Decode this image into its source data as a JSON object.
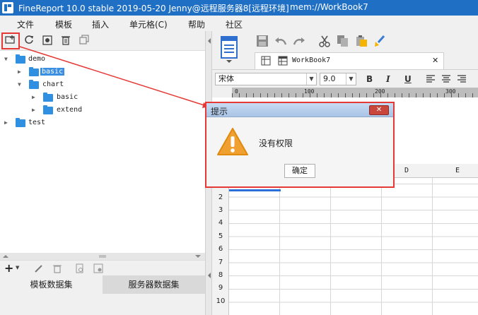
{
  "window": {
    "title": "FineReport 10.0 stable 2019-05-20 Jenny@远程服务器8[远程环境]",
    "path": "mem://WorkBook7"
  },
  "menu": [
    "文件",
    "模板",
    "插入",
    "单元格(C)",
    "帮助",
    "社区"
  ],
  "left_toolbar": {
    "icons": [
      "new-folder-icon",
      "refresh-icon",
      "settings-icon",
      "delete-icon",
      "copy-icon"
    ]
  },
  "tree": [
    {
      "label": "demo",
      "level": 0,
      "expanded": true
    },
    {
      "label": "basic",
      "level": 1,
      "expanded": false,
      "selected": true
    },
    {
      "label": "chart",
      "level": 1,
      "expanded": true
    },
    {
      "label": "basic",
      "level": 2,
      "expanded": false
    },
    {
      "label": "extend",
      "level": 2,
      "expanded": false
    },
    {
      "label": "test",
      "level": 0,
      "expanded": false
    }
  ],
  "left_tabs": [
    "模板数据集",
    "服务器数据集"
  ],
  "doc_tab": {
    "label": "WorkBook7"
  },
  "format": {
    "font": "宋体",
    "size": "9.0",
    "bold": "B",
    "italic": "I",
    "underline": "U"
  },
  "ruler": [
    "0",
    "100",
    "200",
    "300"
  ],
  "columns": [
    "D",
    "E"
  ],
  "rows": [
    "2",
    "3",
    "4",
    "5",
    "6",
    "7",
    "8",
    "9",
    "10"
  ],
  "dialog": {
    "title": "提示",
    "message": "没有权限",
    "ok_label": "确定",
    "close_label": "✕"
  },
  "colors": {
    "title_bar": "#1f6fc4",
    "highlight": "#e53935",
    "folder": "#2f8fe0",
    "selection": "#3b8fe0"
  }
}
